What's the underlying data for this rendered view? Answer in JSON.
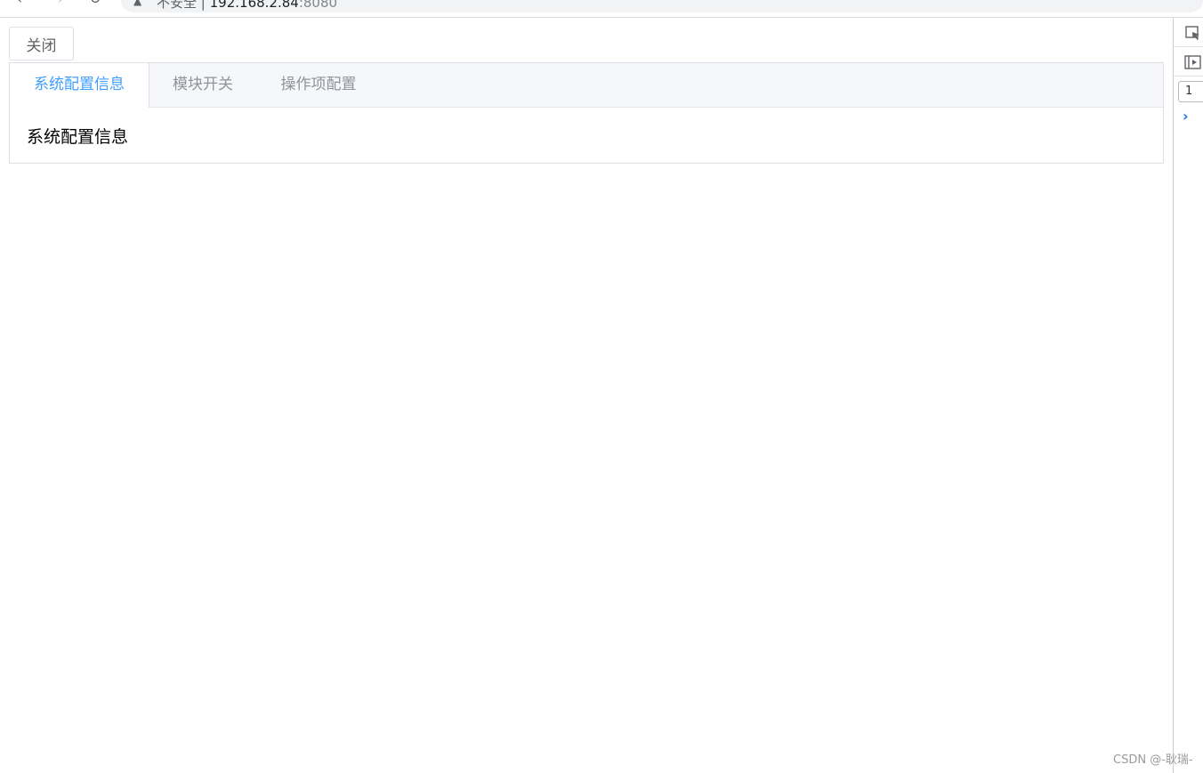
{
  "browser": {
    "url_security": "不安全",
    "url_host": "192.168.2.84",
    "url_port": ":8080"
  },
  "toolbar": {
    "close_label": "关闭"
  },
  "tabs": {
    "items": [
      {
        "label": "系统配置信息",
        "active": true
      },
      {
        "label": "模块开关",
        "active": false
      },
      {
        "label": "操作项配置",
        "active": false
      }
    ],
    "content_text": "系统配置信息"
  },
  "devtools": {
    "select_value": "1"
  },
  "watermark": "CSDN @-耿瑞-",
  "colors": {
    "accent": "#409eff",
    "tab_header_bg": "#f5f7fa",
    "border": "#dcdfe6",
    "inactive_text": "#909399"
  }
}
